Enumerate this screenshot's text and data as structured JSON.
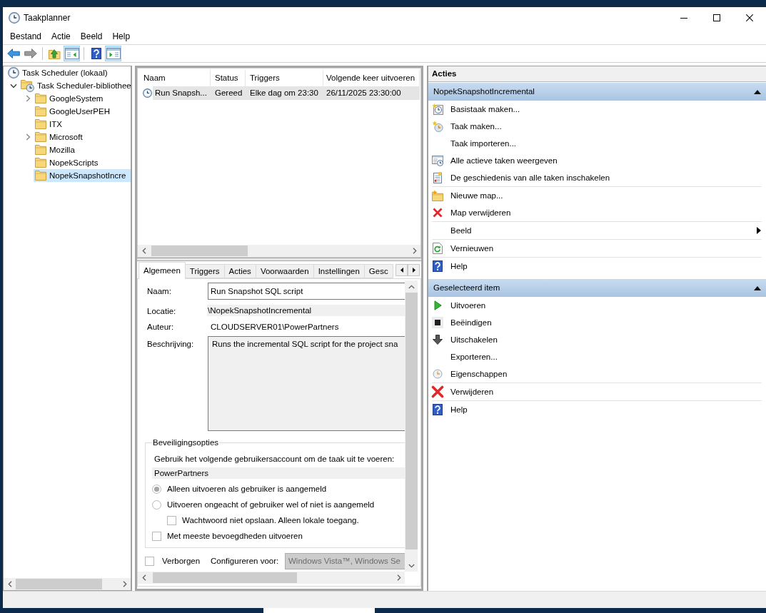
{
  "window": {
    "title": "Taakplanner"
  },
  "menu": [
    {
      "label": "Bestand"
    },
    {
      "label": "Actie"
    },
    {
      "label": "Beeld"
    },
    {
      "label": "Help"
    }
  ],
  "toolbar": [
    {
      "kind": "back",
      "disabled": false
    },
    {
      "kind": "forward",
      "disabled": true
    },
    {
      "kind": "separator"
    },
    {
      "kind": "up"
    },
    {
      "kind": "tree",
      "pressed": true
    },
    {
      "kind": "separator"
    },
    {
      "kind": "help"
    },
    {
      "kind": "pane",
      "pressed": true
    }
  ],
  "tree": [
    {
      "label": "Task Scheduler (lokaal)",
      "kind": "computer",
      "selected": false,
      "children": [
        {
          "label": "Task Scheduler-bibliothee",
          "kind": "library",
          "expanded": true,
          "selected": false,
          "children": [
            {
              "label": "GoogleSystem",
              "kind": "folder",
              "expanded": false,
              "selected": false
            },
            {
              "label": "GoogleUserPEH",
              "kind": "folder",
              "selected": false
            },
            {
              "label": "ITX",
              "kind": "folder",
              "selected": false
            },
            {
              "label": "Microsoft",
              "kind": "folder",
              "expanded": false,
              "selected": false
            },
            {
              "label": "Mozilla",
              "kind": "folder",
              "selected": false
            },
            {
              "label": "NopekScripts",
              "kind": "folder",
              "selected": false
            },
            {
              "label": "NopekSnapshotIncre",
              "kind": "folder",
              "selected": true
            }
          ]
        }
      ]
    }
  ],
  "task_list": {
    "columns": [
      "Naam",
      "Status",
      "Triggers",
      "Volgende keer uitvoeren"
    ],
    "rows": [
      {
        "cells": [
          "Run Snapsh...",
          "Gereed",
          "Elke dag om 23:30",
          "26/11/2025 23:30:00"
        ],
        "selected": true
      }
    ]
  },
  "details": {
    "tabs": [
      {
        "label": "Algemeen",
        "selected": true
      },
      {
        "label": "Triggers",
        "selected": false
      },
      {
        "label": "Acties",
        "selected": false
      },
      {
        "label": "Voorwaarden",
        "selected": false
      },
      {
        "label": "Instellingen",
        "selected": false
      },
      {
        "label": "Gesc",
        "selected": false
      }
    ],
    "general": {
      "name": {
        "label": "Naam:",
        "value": "Run Snapshot SQL script"
      },
      "location": {
        "label": "Locatie:",
        "value": "\\NopekSnapshotIncremental"
      },
      "author": {
        "label": "Auteur:",
        "value": "CLOUDSERVER01\\PowerPartners"
      },
      "description": {
        "label": "Beschrijving:",
        "value": "Runs the incremental SQL script for the project sna"
      }
    },
    "security": {
      "title": "Beveiligingsopties",
      "prompt": "Gebruik het volgende gebruikersaccount om de taak uit te voeren:",
      "account": "PowerPartners",
      "options": [
        {
          "kind": "radio",
          "label": "Alleen uitvoeren als gebruiker is aangemeld",
          "checked": true
        },
        {
          "kind": "radio",
          "label": "Uitvoeren ongeacht of gebruiker wel of niet is aangemeld",
          "checked": false,
          "children": [
            {
              "kind": "checkbox",
              "label": "Wachtwoord niet opslaan. Alleen lokale toegang.",
              "checked": false
            }
          ]
        },
        {
          "kind": "checkbox",
          "label": "Met meeste bevoegdheden uitvoeren",
          "checked": false
        }
      ]
    },
    "hidden": {
      "label": "Verborgen",
      "checked": false
    },
    "configure": {
      "label": "Configureren voor:",
      "value": "Windows Vista™, Windows Se"
    }
  },
  "actions": {
    "title": "Acties",
    "sections": [
      {
        "title": "NopekSnapshotIncremental",
        "expanded": true,
        "groups": [
          [
            {
              "label": "Basistaak maken...",
              "kind": "basic"
            },
            {
              "label": "Taak maken...",
              "kind": "create"
            },
            {
              "label": "Taak importeren...",
              "kind": "import"
            },
            {
              "label": "Alle actieve taken weergeven",
              "kind": "active"
            },
            {
              "label": "De geschiedenis van alle taken inschakelen",
              "kind": "history"
            }
          ],
          [
            {
              "label": "Nieuwe map...",
              "kind": "folder"
            },
            {
              "label": "Map verwijderen",
              "kind": "remove"
            }
          ],
          [
            {
              "label": "Beeld",
              "kind": "submenu"
            }
          ],
          [
            {
              "label": "Vernieuwen",
              "kind": "refresh"
            }
          ],
          [
            {
              "label": "Help",
              "kind": "help"
            }
          ]
        ]
      },
      {
        "title": "Geselecteerd item",
        "expanded": true,
        "groups": [
          [
            {
              "label": "Uitvoeren",
              "kind": "run"
            },
            {
              "label": "Beëindigen",
              "kind": "stop"
            },
            {
              "label": "Uitschakelen",
              "kind": "disable"
            },
            {
              "label": "Exporteren...",
              "kind": "export"
            },
            {
              "label": "Eigenschappen",
              "kind": "properties"
            }
          ],
          [
            {
              "label": "Verwijderen",
              "kind": "delete"
            }
          ],
          [
            {
              "label": "Help",
              "kind": "help"
            }
          ]
        ]
      }
    ]
  }
}
